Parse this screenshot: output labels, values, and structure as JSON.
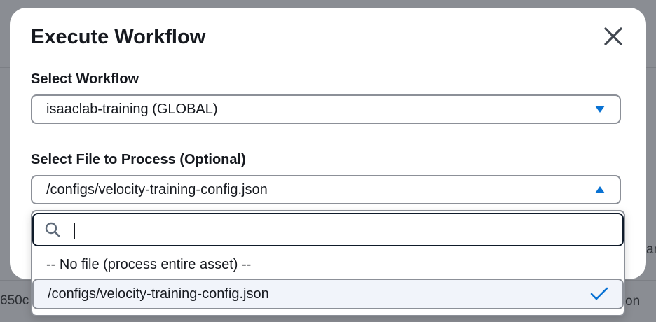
{
  "modal": {
    "title": "Execute Workflow"
  },
  "workflow_field": {
    "label": "Select Workflow",
    "value": "isaaclab-training (GLOBAL)"
  },
  "file_field": {
    "label": "Select File to Process (Optional)",
    "value": "/configs/velocity-training-config.json",
    "search_value": "",
    "options": [
      {
        "label": "-- No file (process entire asset) --",
        "selected": false
      },
      {
        "label": "/configs/velocity-training-config.json",
        "selected": true
      }
    ]
  },
  "background": {
    "left_fragment": "650c",
    "right_fragment_1": "ar",
    "right_fragment_2": "on"
  },
  "colors": {
    "accent": "#0972d3",
    "text": "#16191f",
    "border": "#8c9098",
    "selected_bg": "#f1f4fa",
    "overlay": "#8a8d93"
  },
  "icons": {
    "close": "close-icon",
    "workflow_caret": "caret-down-icon",
    "file_caret": "caret-up-icon",
    "search": "search-icon",
    "selected": "check-icon"
  }
}
